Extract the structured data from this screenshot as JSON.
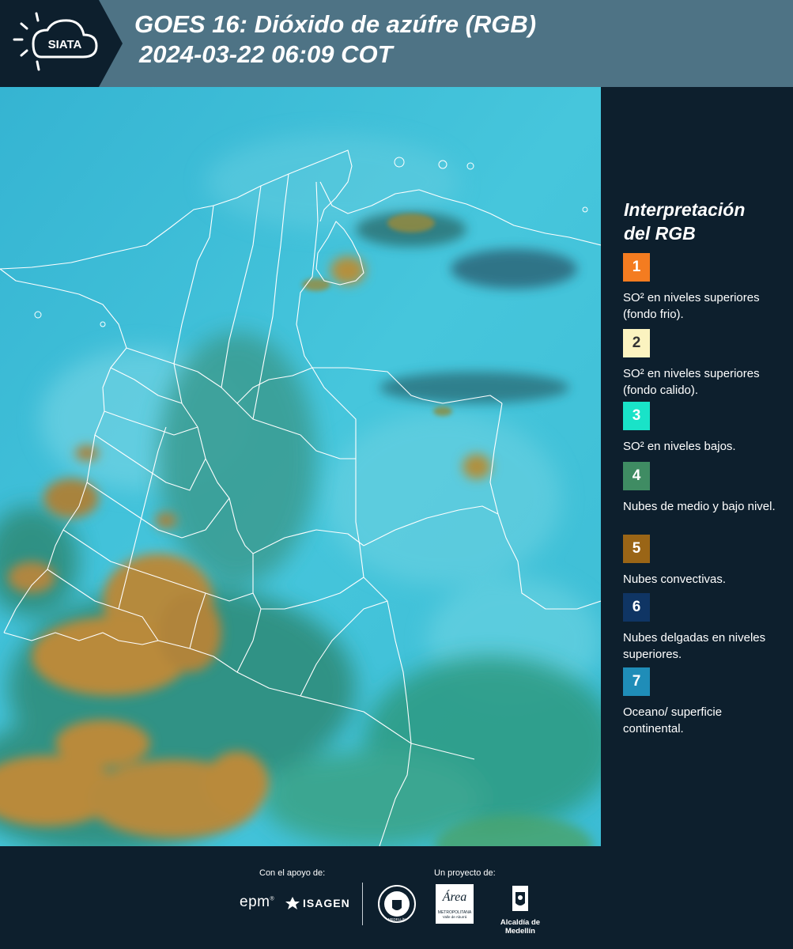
{
  "header": {
    "logo_text": "SIATA",
    "title_line1": "GOES 16: Dióxido de azúfre (RGB)",
    "title_line2": "2024-03-22 06:09 COT"
  },
  "legend": {
    "title_line1": "Interpretación",
    "title_line2": "del RGB",
    "items": [
      {
        "number": "1",
        "color": "#f47c20",
        "label": "SO² en niveles superiores (fondo frio)."
      },
      {
        "number": "2",
        "color": "#fbf3c0",
        "label": "SO² en niveles superiores (fondo calido)."
      },
      {
        "number": "3",
        "color": "#19e3c8",
        "label": "SO² en niveles bajos."
      },
      {
        "number": "4",
        "color": "#3f8c63",
        "label": "Nubes de medio y bajo nivel."
      },
      {
        "number": "5",
        "color": "#9a6516",
        "label": "Nubes convectivas."
      },
      {
        "number": "6",
        "color": "#0f3564",
        "label": "Nubes delgadas en niveles superiores."
      },
      {
        "number": "7",
        "color": "#1f8db8",
        "label": "Oceano/ superficie continental."
      }
    ]
  },
  "footer": {
    "support_label": "Con el apoyo de:",
    "project_label": "Un proyecto de:",
    "sponsors": {
      "epm": "epm",
      "isagen": "ISAGEN",
      "medellin_seal": "MEDELLÍN",
      "area_name": "Área",
      "area_sub": "METROPOLITANA",
      "area_sub2": "Valle de Aburrá",
      "alcaldia": "Alcaldía de Medellín"
    }
  },
  "map": {
    "background_color": "#3fc4dc",
    "convective_color": "#b98a3a",
    "lowcloud_color": "#3f9a86",
    "border_color": "#ffffff"
  }
}
